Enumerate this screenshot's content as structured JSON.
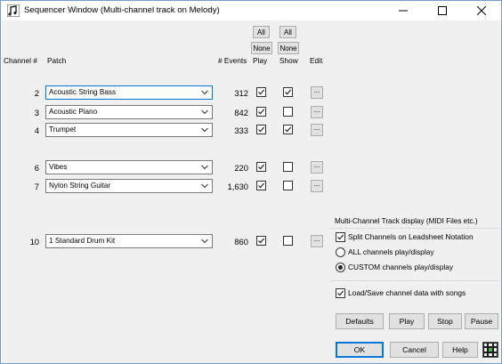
{
  "window": {
    "title": "Sequencer Window  (Multi-channel track on Melody)",
    "controls": {
      "minimize": "—",
      "maximize": "☐",
      "close": "✕"
    }
  },
  "header": {
    "all_play": "All",
    "all_show": "All",
    "none_play": "None",
    "none_show": "None",
    "channel": "Channel #",
    "patch": "Patch",
    "events": "# Events",
    "play": "Play",
    "show": "Show",
    "edit": "Edit"
  },
  "rows": [
    {
      "channel": "2",
      "patch": "Acoustic String Bass",
      "events": "312",
      "play": true,
      "show": true,
      "edit": "..."
    },
    {
      "channel": "3",
      "patch": "Acoustic Piano",
      "events": "842",
      "play": true,
      "show": false,
      "edit": "..."
    },
    {
      "channel": "4",
      "patch": "Trumpet",
      "events": "333",
      "play": true,
      "show": true,
      "edit": "..."
    },
    {
      "channel": "6",
      "patch": "Vibes",
      "events": "220",
      "play": true,
      "show": false,
      "edit": "..."
    },
    {
      "channel": "7",
      "patch": "Nylon String Guitar",
      "events": "1,630",
      "play": true,
      "show": false,
      "edit": "..."
    },
    {
      "channel": "10",
      "patch": "1 Standard Drum Kit",
      "events": "860",
      "play": true,
      "show": false,
      "edit": "..."
    }
  ],
  "multichannel": {
    "title": "Multi-Channel Track display (MIDI Files etc.)",
    "split_label": "Split Channels on Leadsheet Notation",
    "split_checked": true,
    "all_label": "ALL channels play/display",
    "custom_label": "CUSTOM channels play/display",
    "selected": "custom"
  },
  "loadsave": {
    "label": "Load/Save channel data with songs",
    "checked": true
  },
  "buttons": {
    "defaults": "Defaults",
    "play": "Play",
    "stop": "Stop",
    "pause": "Pause",
    "ok": "OK",
    "cancel": "Cancel",
    "help": "Help"
  },
  "icons": {
    "app": "bandinabox-app-icon",
    "chevron": "chevron-down-icon",
    "check": "check-icon",
    "grid": "film-grid-icon"
  },
  "colors": {
    "accent": "#0078d7",
    "face": "#f0f0f0",
    "button": "#e1e1e1"
  }
}
